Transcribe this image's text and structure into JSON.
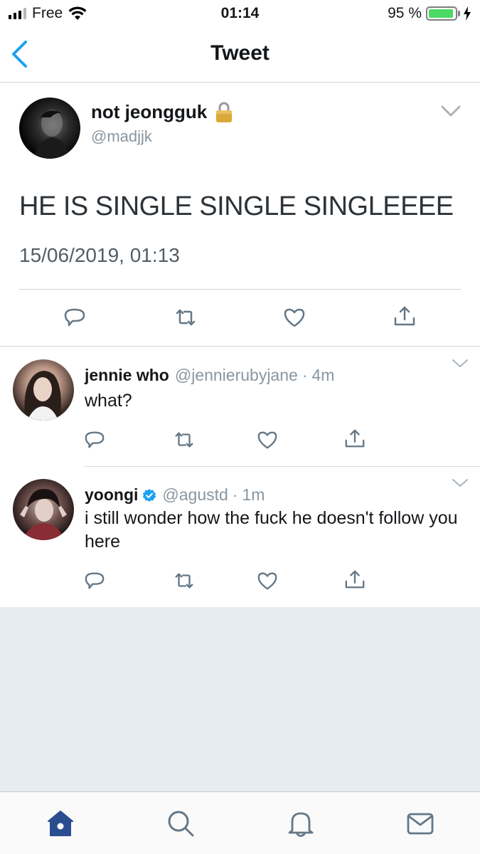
{
  "status_bar": {
    "carrier": "Free",
    "time": "01:14",
    "battery": "95 %",
    "battery_level": 0.95
  },
  "nav": {
    "title": "Tweet",
    "back_icon": "chevron-left-icon"
  },
  "main_tweet": {
    "name": "not jeongguk",
    "handle": "@madjjk",
    "protected_icon": "lock-icon",
    "text": "HE IS SINGLE SINGLE SINGLEEEE",
    "timestamp": "15/06/2019, 01:13"
  },
  "replies": [
    {
      "name": "jennie who",
      "handle": "@jennierubyjane",
      "dot": "·",
      "time": "4m",
      "text": "what?"
    },
    {
      "name": "yoongi",
      "verified": true,
      "handle": "@agustd",
      "dot": "·",
      "time": "1m",
      "text": "i still wonder how the fuck he doesn't follow you here"
    }
  ],
  "actions": [
    "reply-icon",
    "retweet-icon",
    "like-icon",
    "share-icon"
  ],
  "tab_bar": [
    "home-icon",
    "search-icon",
    "notifications-icon",
    "messages-icon"
  ],
  "colors": {
    "accent": "#1da1f2",
    "tab_active": "#2a4d8f",
    "icon_gray": "#657786",
    "background_gray": "#e6ecf0"
  }
}
